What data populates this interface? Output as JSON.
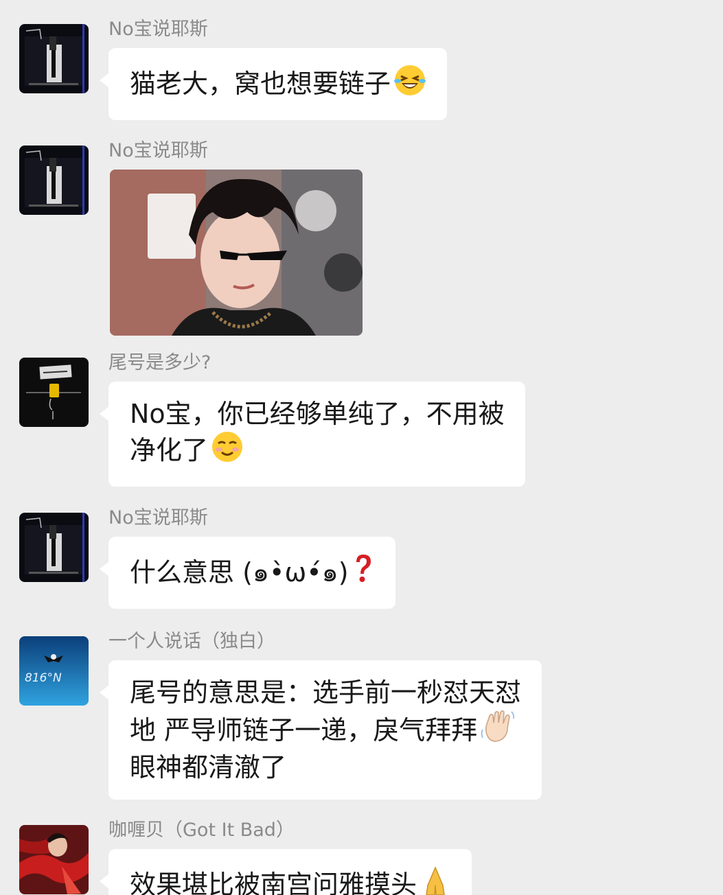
{
  "messages": [
    {
      "sender": "No宝说耶斯",
      "lines": [
        "猫老大，窝也想要链子"
      ],
      "emoji": "laughing-tears-emoji"
    },
    {
      "sender": "No宝说耶斯",
      "image": "photo-young-man-sunglasses"
    },
    {
      "sender": "尾号是多少?",
      "lines": [
        "No宝，你已经够单纯了，不用被",
        "净化了"
      ],
      "emoji": "smiling-blush-emoji"
    },
    {
      "sender": "No宝说耶斯",
      "lines": [
        "什么意思 (๑•̀ω•́๑)"
      ],
      "emoji": "red-question-emoji"
    },
    {
      "sender": "一个人说话（独白）",
      "lines": [
        "尾号的意思是：选手前一秒怼天怼",
        "地  严导师链子一递，戾气拜拜",
        "眼神都清澈了"
      ],
      "emoji": "waving-hand-emoji"
    },
    {
      "sender": "咖喱贝（Got It Bad）",
      "lines": [
        "效果堪比被南宫问雅摸头"
      ],
      "emoji": "folded-hands-emoji"
    }
  ],
  "avatar_text": {
    "m4": "816°N"
  },
  "colors": {
    "background": "#ededed",
    "bubble": "#ffffff",
    "sender": "#8a8a8a",
    "text": "#191919"
  }
}
